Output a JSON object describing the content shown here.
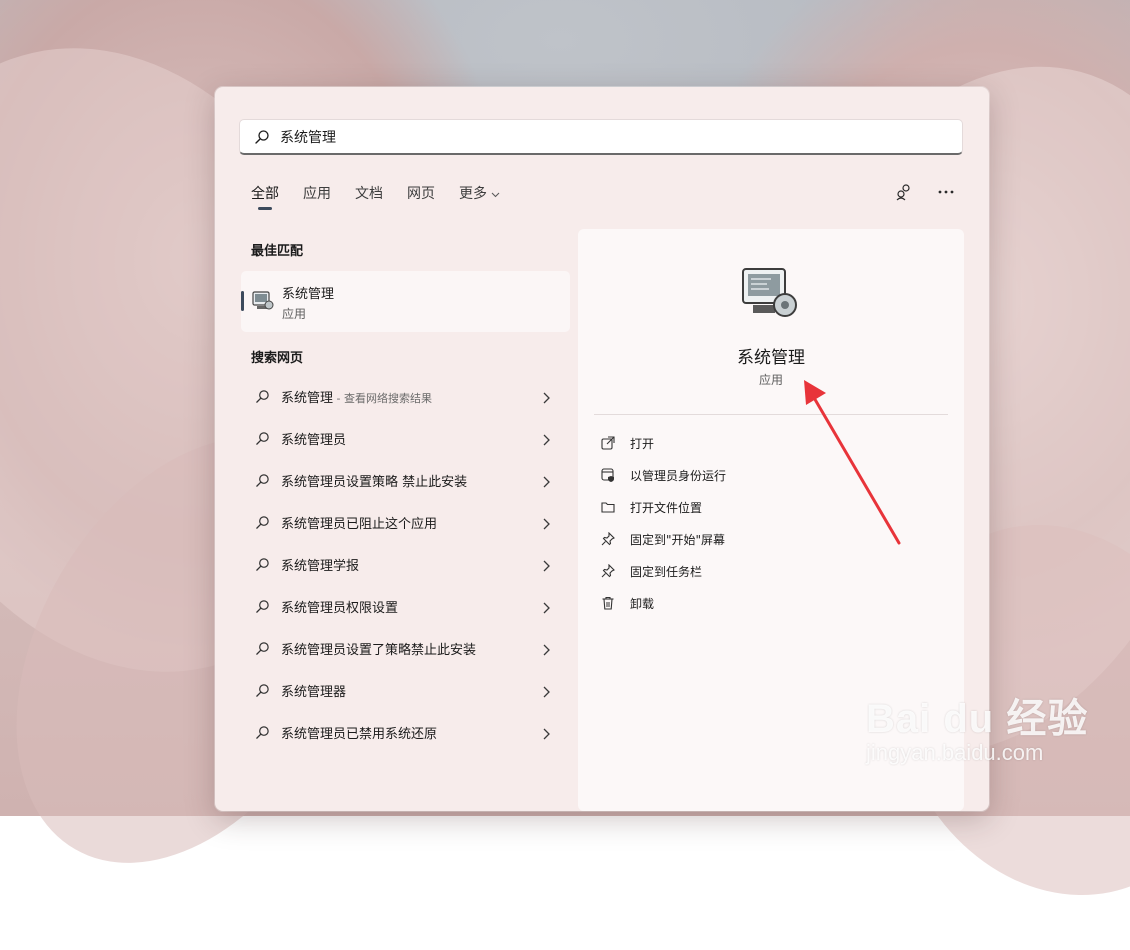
{
  "search": {
    "value": "系统管理"
  },
  "tabs": [
    {
      "label": "全部",
      "active": true
    },
    {
      "label": "应用"
    },
    {
      "label": "文档"
    },
    {
      "label": "网页"
    },
    {
      "label": "更多"
    }
  ],
  "best_match": {
    "section_title": "最佳匹配",
    "name": "系统管理",
    "type": "应用"
  },
  "web": {
    "section_title": "搜索网页",
    "items": [
      {
        "text": "系统管理",
        "hint": " - 查看网络搜索结果"
      },
      {
        "text": "系统管理员"
      },
      {
        "text": "系统管理员设置策略 禁止此安装"
      },
      {
        "text": "系统管理员已阻止这个应用"
      },
      {
        "text": "系统管理学报"
      },
      {
        "text": "系统管理员权限设置"
      },
      {
        "text": "系统管理员设置了策略禁止此安装"
      },
      {
        "text": "系统管理器"
      },
      {
        "text": "系统管理员已禁用系统还原"
      }
    ]
  },
  "detail": {
    "title": "系统管理",
    "subtitle": "应用",
    "actions": [
      {
        "label": "打开",
        "icon": "open-external-icon"
      },
      {
        "label": "以管理员身份运行",
        "icon": "run-as-admin-icon"
      },
      {
        "label": "打开文件位置",
        "icon": "folder-icon"
      },
      {
        "label": "固定到\"开始\"屏幕",
        "icon": "pin-icon"
      },
      {
        "label": "固定到任务栏",
        "icon": "pin-icon"
      },
      {
        "label": "卸载",
        "icon": "trash-icon"
      }
    ]
  },
  "watermark": {
    "brand": "Bai du 经验",
    "url": "jingyan.baidu.com"
  },
  "colors": {
    "accent": "#3c4a5c",
    "arrow": "#e8343a"
  }
}
